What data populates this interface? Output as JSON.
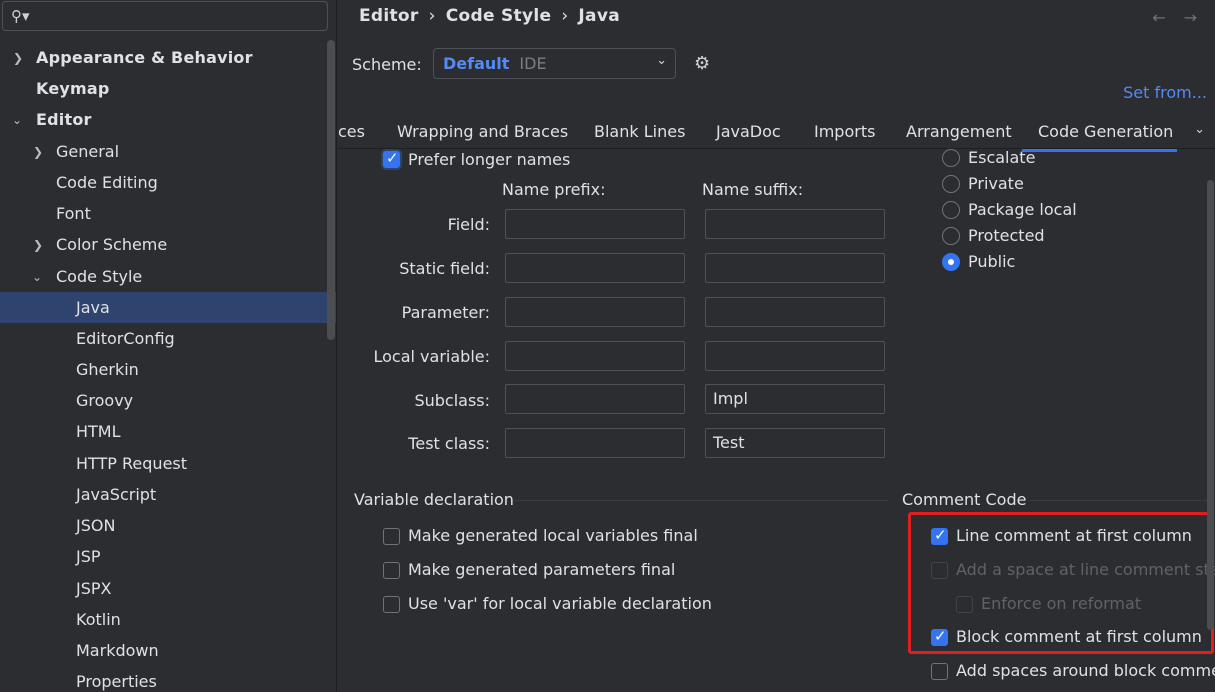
{
  "search": {
    "placeholder": ""
  },
  "sidebar": {
    "items": [
      {
        "label": "Appearance & Behavior"
      },
      {
        "label": "Keymap"
      },
      {
        "label": "Editor"
      },
      {
        "label": "General"
      },
      {
        "label": "Code Editing"
      },
      {
        "label": "Font"
      },
      {
        "label": "Color Scheme"
      },
      {
        "label": "Code Style"
      },
      {
        "label": "Java"
      },
      {
        "label": "EditorConfig"
      },
      {
        "label": "Gherkin"
      },
      {
        "label": "Groovy"
      },
      {
        "label": "HTML"
      },
      {
        "label": "HTTP Request"
      },
      {
        "label": "JavaScript"
      },
      {
        "label": "JSON"
      },
      {
        "label": "JSP"
      },
      {
        "label": "JSPX"
      },
      {
        "label": "Kotlin"
      },
      {
        "label": "Markdown"
      },
      {
        "label": "Properties"
      }
    ]
  },
  "breadcrumb": {
    "items": [
      "Editor",
      "Code Style",
      "Java"
    ],
    "sep": "›"
  },
  "scheme": {
    "label": "Scheme:",
    "value": "Default",
    "scope": "IDE"
  },
  "set_from": "Set from...",
  "tabs": [
    "ces",
    "Wrapping and Braces",
    "Blank Lines",
    "JavaDoc",
    "Imports",
    "Arrangement",
    "Code Generation"
  ],
  "naming": {
    "prefer_longer_names": "Prefer longer names",
    "prefix_header": "Name prefix:",
    "suffix_header": "Name suffix:",
    "rows": [
      {
        "label": "Field:",
        "prefix": "",
        "suffix": ""
      },
      {
        "label": "Static field:",
        "prefix": "",
        "suffix": ""
      },
      {
        "label": "Parameter:",
        "prefix": "",
        "suffix": ""
      },
      {
        "label": "Local variable:",
        "prefix": "",
        "suffix": ""
      },
      {
        "label": "Subclass:",
        "prefix": "",
        "suffix": "Impl"
      },
      {
        "label": "Test class:",
        "prefix": "",
        "suffix": "Test"
      }
    ]
  },
  "visibility": {
    "options": [
      "Escalate",
      "Private",
      "Package local",
      "Protected",
      "Public"
    ],
    "selected": "Public"
  },
  "variable_declaration": {
    "title": "Variable declaration",
    "options": [
      "Make generated local variables final",
      "Make generated parameters final",
      "Use 'var' for local variable declaration"
    ]
  },
  "comment_code": {
    "title": "Comment Code",
    "line_comment_first_column": "Line comment at first column",
    "add_space_line_comment": "Add a space at line comment sta",
    "enforce_on_reformat": "Enforce on reformat",
    "block_comment_first_column": "Block comment at first column",
    "add_spaces_block_comment": "Add spaces around block comme"
  },
  "colors": {
    "accent": "#3574f0",
    "highlight_box": "#e02020",
    "selection": "#2e436e"
  }
}
